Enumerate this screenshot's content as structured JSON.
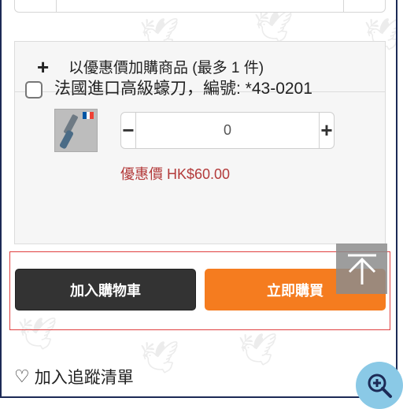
{
  "addon": {
    "title": "以優惠價加購商品 (最多 1 件)",
    "item": {
      "name": "法國進口高級蠔刀，編號: *43-0201",
      "quantity": "0",
      "promo_price": "優惠價 HK$60.00",
      "flag_colors": [
        "#0055a4",
        "#ffffff",
        "#ef4135"
      ]
    }
  },
  "actions": {
    "add_to_cart": "加入購物車",
    "buy_now": "立即購買"
  },
  "wishlist": {
    "label": "加入追蹤清單"
  },
  "icons": {
    "plus": "plus-icon",
    "minus": "minus-icon",
    "back_to_top": "arrow-up-icon",
    "wishlist": "heart-icon",
    "zoom": "zoom-in-icon"
  },
  "colors": {
    "buy_now": "#f57c1f",
    "add_to_cart": "#333333",
    "promo_price": "#b33a3a",
    "zoom_button": "#8ac9e6",
    "highlight_border": "#e04040"
  }
}
